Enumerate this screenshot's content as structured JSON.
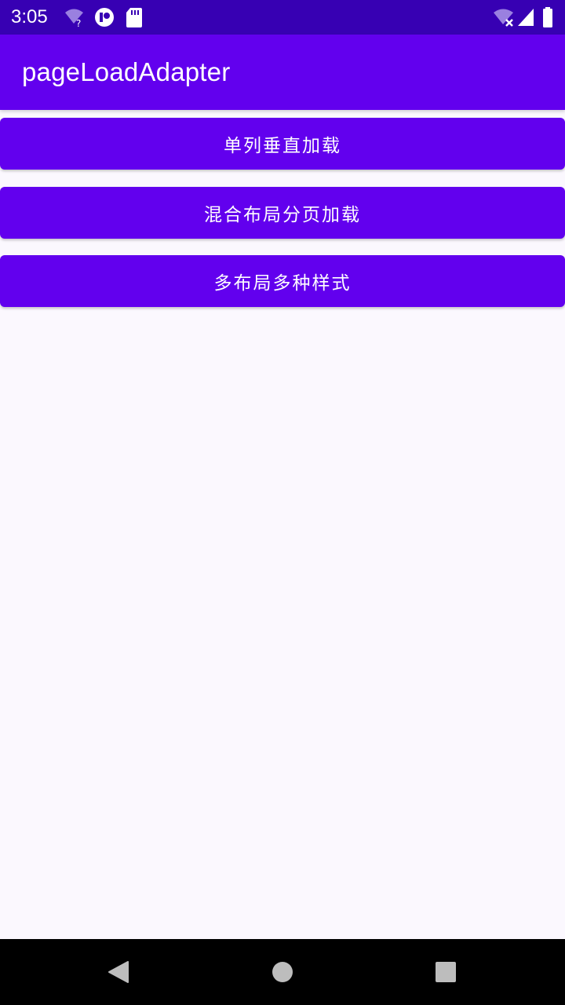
{
  "status_bar": {
    "time": "3:05",
    "icons": [
      "wifi-question-icon",
      "app-notification-icon",
      "sd-card-icon",
      "wifi-off-icon",
      "cell-signal-icon",
      "battery-icon"
    ],
    "background": "#3700b3"
  },
  "app_bar": {
    "title": "pageLoadAdapter",
    "background": "#6200ee"
  },
  "buttons": [
    {
      "label": "单列垂直加载"
    },
    {
      "label": "混合布局分页加载"
    },
    {
      "label": "多布局多种样式"
    }
  ],
  "nav_bar": {
    "icons": [
      "back-icon",
      "home-icon",
      "recents-icon"
    ],
    "background": "#000000"
  },
  "colors": {
    "primary": "#6200ee",
    "primary_dark": "#3700b3",
    "page_background": "#fbf8fe"
  }
}
